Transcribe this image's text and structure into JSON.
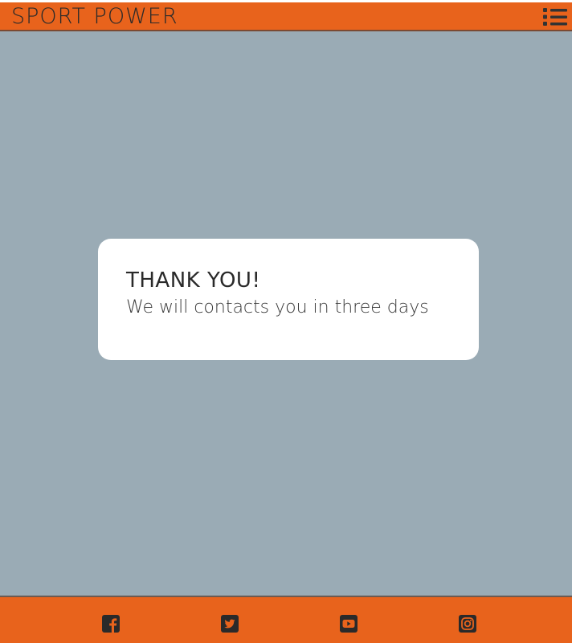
{
  "header": {
    "brand": "SPORT POWER",
    "menu_icon": "list-icon"
  },
  "modal": {
    "title": "THANK YOU!",
    "message": "We will contacts you in three days"
  },
  "footer": {
    "social": [
      {
        "name": "facebook",
        "icon": "facebook-square-icon"
      },
      {
        "name": "twitter",
        "icon": "twitter-square-icon"
      },
      {
        "name": "youtube",
        "icon": "youtube-square-icon"
      },
      {
        "name": "instagram",
        "icon": "instagram-square-icon"
      }
    ]
  },
  "colors": {
    "accent": "#e8631c",
    "background": "#9aabb5",
    "card": "#ffffff",
    "text": "#2a2a2a"
  }
}
